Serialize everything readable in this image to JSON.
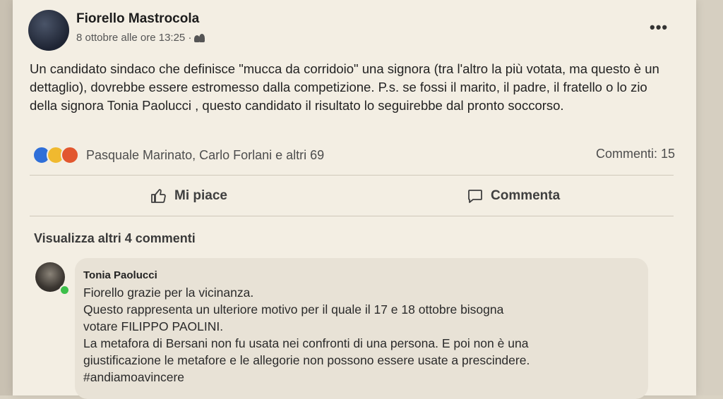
{
  "post": {
    "author": "Fiorello Mastrocola",
    "timestamp": "8 ottobre alle ore 13:25 ·",
    "audience_icon": "friends-icon",
    "more_label": "•••",
    "text": "Un candidato sindaco che definisce \"mucca da corridoio\" una signora (tra l'altro la più votata, ma questo è un dettaglio), dovrebbe essere estromesso dalla competizione. P.s. se fossi il marito, il padre, il fratello o lo zio della signora Tonia Paolucci , questo candidato il risultato lo seguirebbe dal pronto soccorso.",
    "reactions": [
      "like",
      "haha",
      "angry"
    ],
    "reactors": "Pasquale Marinato, Carlo Forlani e altri 69",
    "comments_count": "Commenti: 15"
  },
  "actions": {
    "like_label": "Mi piace",
    "comment_label": "Commenta"
  },
  "comments": {
    "show_more": "Visualizza altri 4 commenti",
    "items": [
      {
        "author": "Tonia Paolucci",
        "lines": [
          "Fiorello grazie per la vicinanza.",
          "Questo rappresenta un ulteriore motivo per il quale il 17 e 18 ottobre bisogna",
          "votare FILIPPO PAOLINI.",
          "La metafora di Bersani non fu usata nei confronti di una persona. E poi non è una",
          "giustificazione le metafore e le allegorie non possono essere usate a prescindere.",
          "#andiamoavincere"
        ]
      }
    ]
  },
  "colors": {
    "like": "#2f6fd8",
    "haha": "#f0b92f",
    "angry": "#e2572f",
    "online": "#3cbf4a"
  }
}
